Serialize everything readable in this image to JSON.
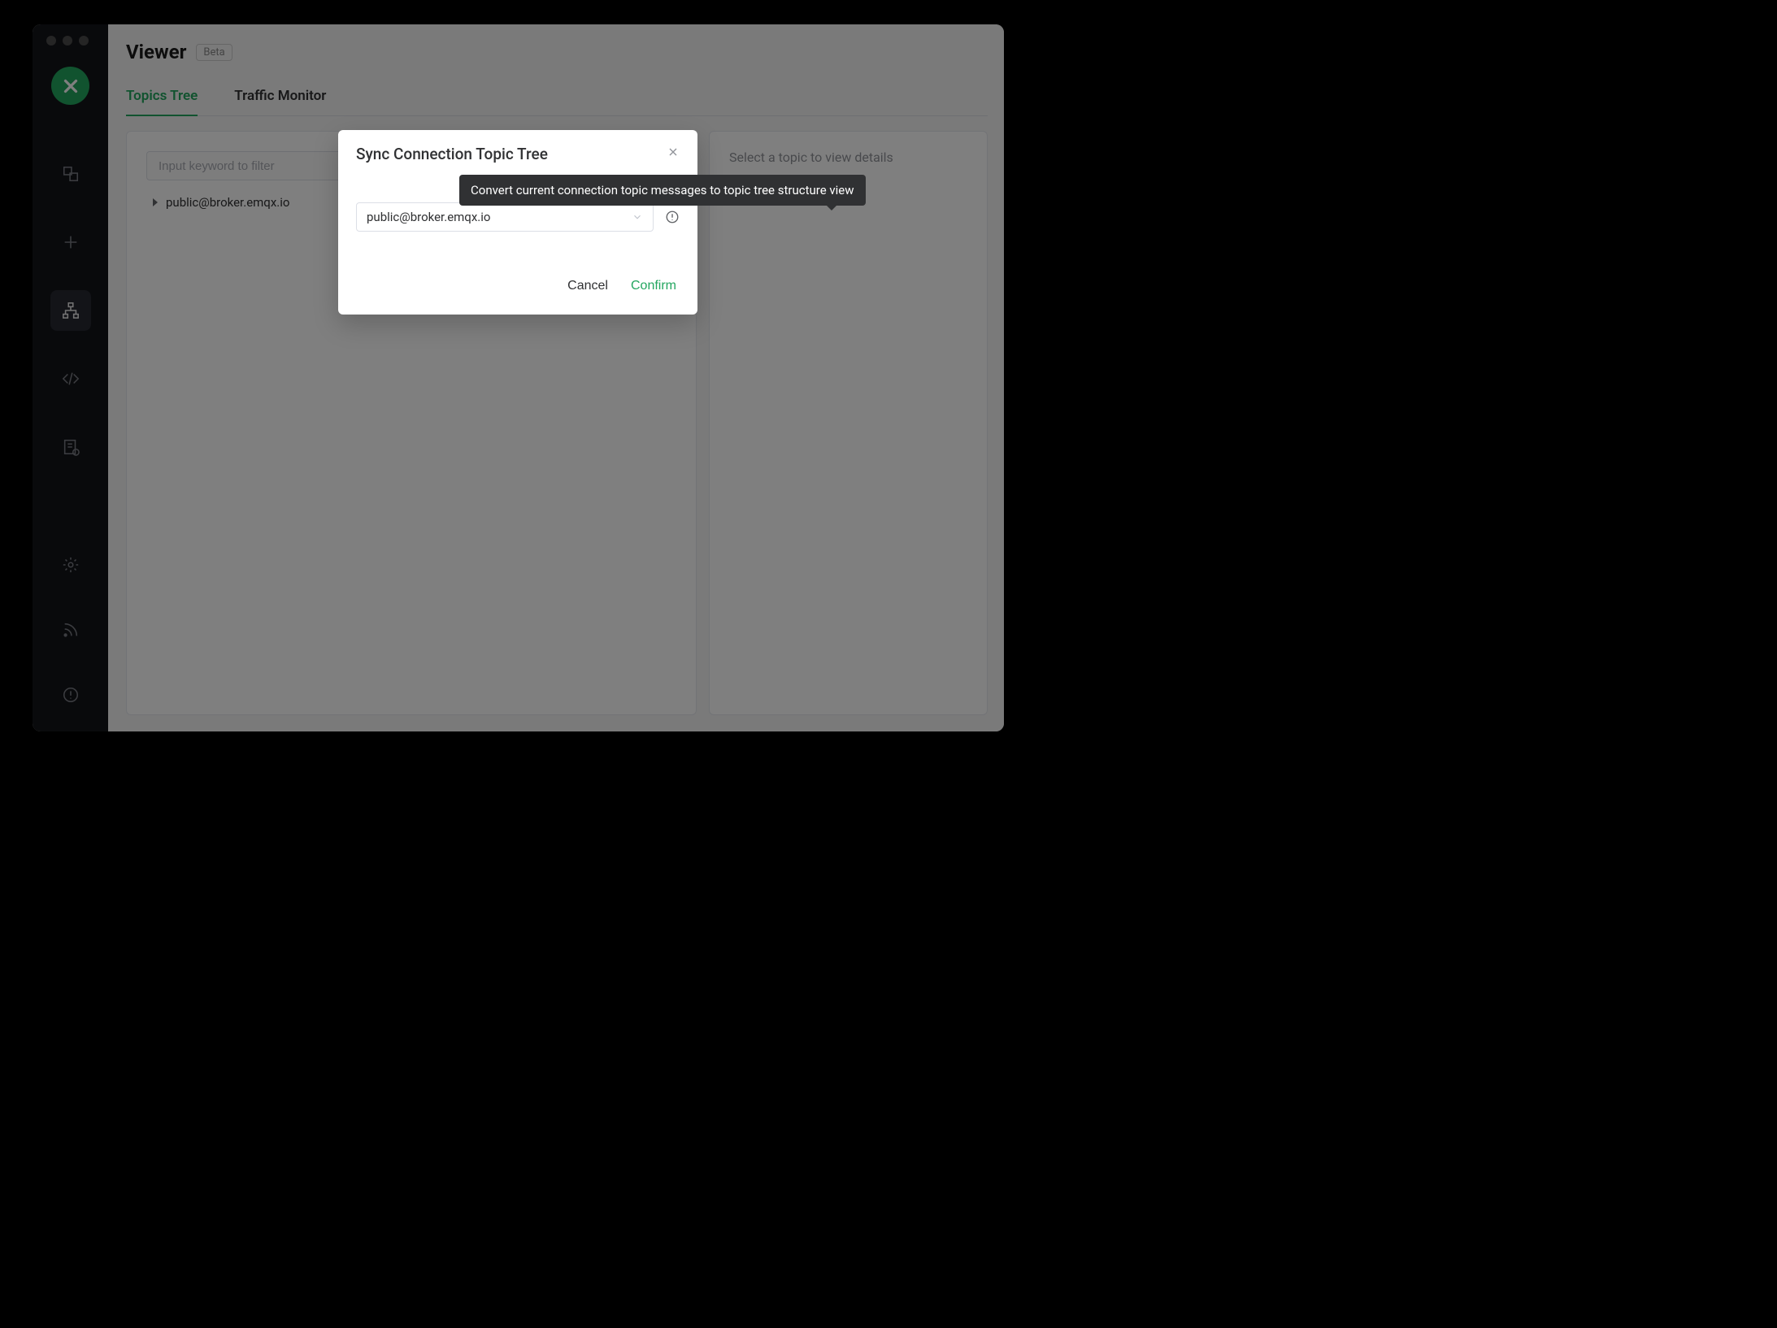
{
  "header": {
    "title": "Viewer",
    "badge": "Beta"
  },
  "tabs": {
    "topics_tree": "Topics Tree",
    "traffic_monitor": "Traffic Monitor"
  },
  "left_panel": {
    "filter_placeholder": "Input keyword to filter",
    "tree_item": "public@broker.emqx.io"
  },
  "right_panel": {
    "placeholder": "Select a topic to view details"
  },
  "dialog": {
    "title": "Sync Connection Topic Tree",
    "select_value": "public@broker.emqx.io",
    "cancel_label": "Cancel",
    "confirm_label": "Confirm"
  },
  "tooltip": {
    "text": "Convert current connection topic messages to topic tree structure view"
  },
  "sidebar_icons": [
    "connections",
    "new",
    "topic-tree",
    "scripts",
    "logs",
    "settings",
    "feed",
    "help"
  ],
  "colors": {
    "accent": "#23a65f"
  }
}
